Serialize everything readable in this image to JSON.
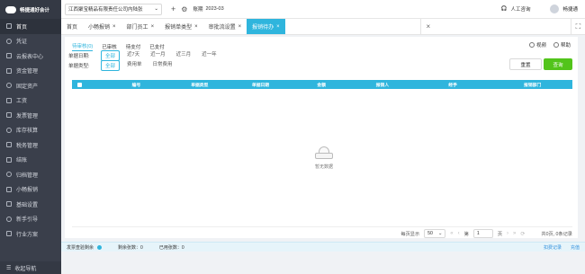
{
  "app": {
    "logo": "畅捷通好会计"
  },
  "sidebar": {
    "items": [
      {
        "label": "首页",
        "icon": "home-icon"
      },
      {
        "label": "凭证",
        "icon": "voucher-icon"
      },
      {
        "label": "云报表中心",
        "icon": "report-icon"
      },
      {
        "label": "资金管理",
        "icon": "money-icon"
      },
      {
        "label": "固定资产",
        "icon": "asset-icon"
      },
      {
        "label": "工资",
        "icon": "salary-icon"
      },
      {
        "label": "发票管理",
        "icon": "invoice-icon"
      },
      {
        "label": "库存核算",
        "icon": "inventory-icon"
      },
      {
        "label": "税务管理",
        "icon": "tax-icon"
      },
      {
        "label": "结账",
        "icon": "checkout-icon"
      },
      {
        "label": "归档管理",
        "icon": "archive-icon"
      },
      {
        "label": "小畅报销",
        "icon": "reimburse-icon"
      },
      {
        "label": "基础设置",
        "icon": "settings-icon"
      },
      {
        "label": "新手引导",
        "icon": "guide-icon"
      },
      {
        "label": "行业方案",
        "icon": "solution-icon"
      }
    ],
    "collapse_label": "收起导航"
  },
  "topbar": {
    "company": "江西聚宝精品有限责任公司内陆张",
    "add": "+",
    "settings": "⚙",
    "period_label": "账期",
    "period_value": "2023-03",
    "support": "人工咨询",
    "user": "畅捷通"
  },
  "tabs": [
    {
      "label": "首页",
      "closable": false
    },
    {
      "label": "小畅报销",
      "closable": true
    },
    {
      "label": "部门员工",
      "closable": true
    },
    {
      "label": "报销单类型",
      "closable": true
    },
    {
      "label": "审批流设置",
      "closable": true
    },
    {
      "label": "报销待办",
      "closable": true,
      "active": true
    }
  ],
  "status_tabs": [
    "待审核(0)",
    "已审核",
    "待支付",
    "已支付"
  ],
  "video_label": "视频",
  "help_label": "帮助",
  "filters": {
    "date": {
      "label": "单据日期:",
      "options": [
        "全部",
        "近7天",
        "近一月",
        "近三月",
        "近一年"
      ]
    },
    "type": {
      "label": "单据类型:",
      "options": [
        "全部",
        "费用单",
        "日常费用"
      ]
    }
  },
  "buttons": {
    "reset": "重置",
    "query": "查询"
  },
  "table": {
    "columns": [
      "编号",
      "单据类型",
      "单据日期",
      "金额",
      "报销人",
      "经手",
      "报销部门"
    ]
  },
  "empty_text": "暂无数据",
  "pager": {
    "per_page_label": "每页显示",
    "per_page": "50",
    "page_prefix": "第",
    "page": "1",
    "page_suffix": "页",
    "summary": "共0页, 0条记录"
  },
  "bottom": {
    "invoice_label": "发票查验剩余",
    "invoice_remaining": "剩余张数：0",
    "invoice_used": "已用张数：0",
    "link1": "扣费记录",
    "link2": "充值"
  },
  "colors": {
    "accent": "#2fb5dd",
    "query": "#52c41a",
    "sidebar": "#3a3f4b"
  }
}
